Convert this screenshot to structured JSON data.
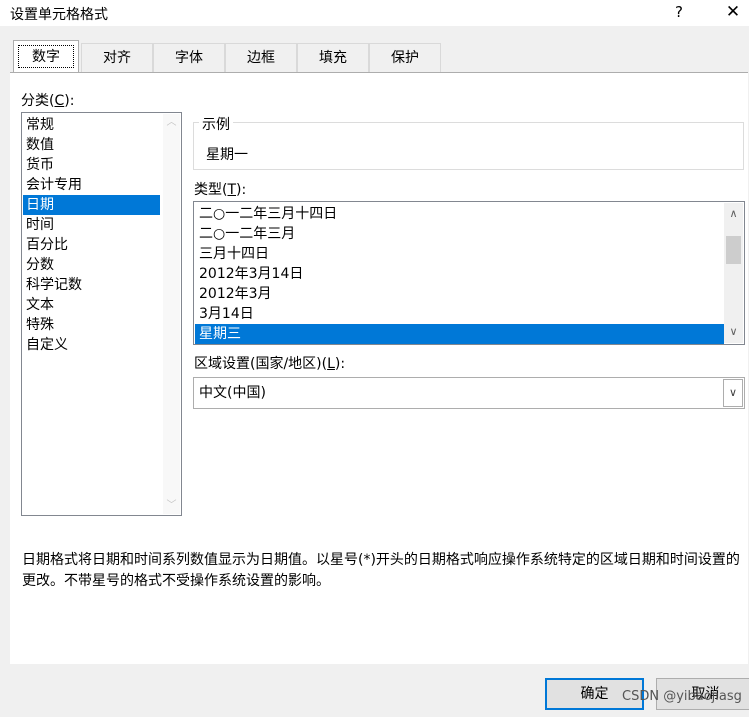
{
  "window": {
    "title": "设置单元格格式",
    "help_glyph": "?",
    "close_glyph": "✕"
  },
  "tabs": [
    {
      "label": "数字",
      "active": true
    },
    {
      "label": "对齐",
      "active": false
    },
    {
      "label": "字体",
      "active": false
    },
    {
      "label": "边框",
      "active": false
    },
    {
      "label": "填充",
      "active": false
    },
    {
      "label": "保护",
      "active": false
    }
  ],
  "category": {
    "label": "分类",
    "hotkey": "C",
    "items": [
      "常规",
      "数值",
      "货币",
      "会计专用",
      "日期",
      "时间",
      "百分比",
      "分数",
      "科学记数",
      "文本",
      "特殊",
      "自定义"
    ],
    "selected": "日期"
  },
  "sample": {
    "label": "示例",
    "value": "星期一"
  },
  "type": {
    "label": "类型",
    "hotkey": "T",
    "items": [
      "二○一二年三月十四日",
      "二○一二年三月",
      "三月十四日",
      "2012年3月14日",
      "2012年3月",
      "3月14日",
      "星期三"
    ],
    "selected": "星期三"
  },
  "locale": {
    "label": "区域设置(国家/地区)",
    "hotkey": "L",
    "value": "中文(中国)"
  },
  "description": "日期格式将日期和时间系列数值显示为日期值。以星号(*)开头的日期格式响应操作系统特定的区域日期和时间设置的更改。不带星号的格式不受操作系统设置的影响。",
  "buttons": {
    "ok": "确定",
    "cancel": "取消"
  },
  "watermark": "CSDN @yibaojiasg",
  "colors": {
    "selection": "#0078d7",
    "dialog_bg": "#f0f0f0"
  }
}
